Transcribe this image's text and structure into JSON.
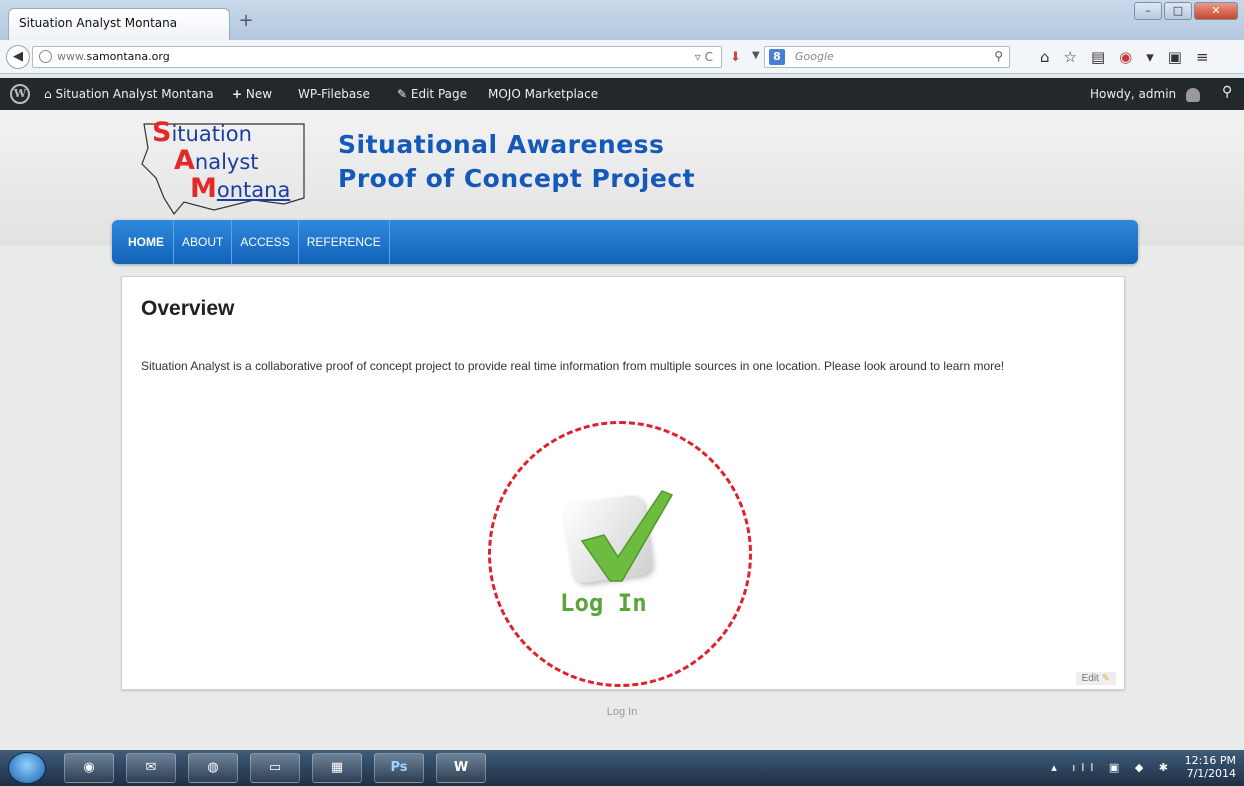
{
  "browser": {
    "tab_title": "Situation Analyst Montana",
    "url_prefix": "www.",
    "url_domain": "samontana.org",
    "search_engine": "Google"
  },
  "adminbar": {
    "site_name": "Situation Analyst Montana",
    "new_label": "New",
    "filebase_label": "WP-Filebase",
    "edit_page_label": "Edit Page",
    "marketplace_label": "MOJO Marketplace",
    "greeting": "Howdy, admin"
  },
  "logo": {
    "line1_cap": "S",
    "line1_rest": "ituation",
    "line2_cap": "A",
    "line2_rest": "nalyst",
    "line3_cap": "M",
    "line3_rest": "ontana"
  },
  "header": {
    "line1": "Situational Awareness",
    "line2": "Proof of Concept Project"
  },
  "nav": {
    "items": [
      "HOME",
      "ABOUT",
      "ACCESS",
      "REFERENCE"
    ]
  },
  "content": {
    "title": "Overview",
    "body": "Situation Analyst is a collaborative proof of concept project to provide real time information from multiple sources in one location.  Please look around to learn more!",
    "login_label": "Log In",
    "edit_label": "Edit"
  },
  "footer": {
    "login_link": "Log In"
  },
  "taskbar": {
    "ps_label": "Ps",
    "time": "12:16 PM",
    "date": "7/1/2014"
  },
  "colors": {
    "nav_blue": "#1a6fc8",
    "header_blue": "#1458b9",
    "callout_red": "#e0202a",
    "check_green": "#5aa43a",
    "adminbar": "#23282d"
  }
}
